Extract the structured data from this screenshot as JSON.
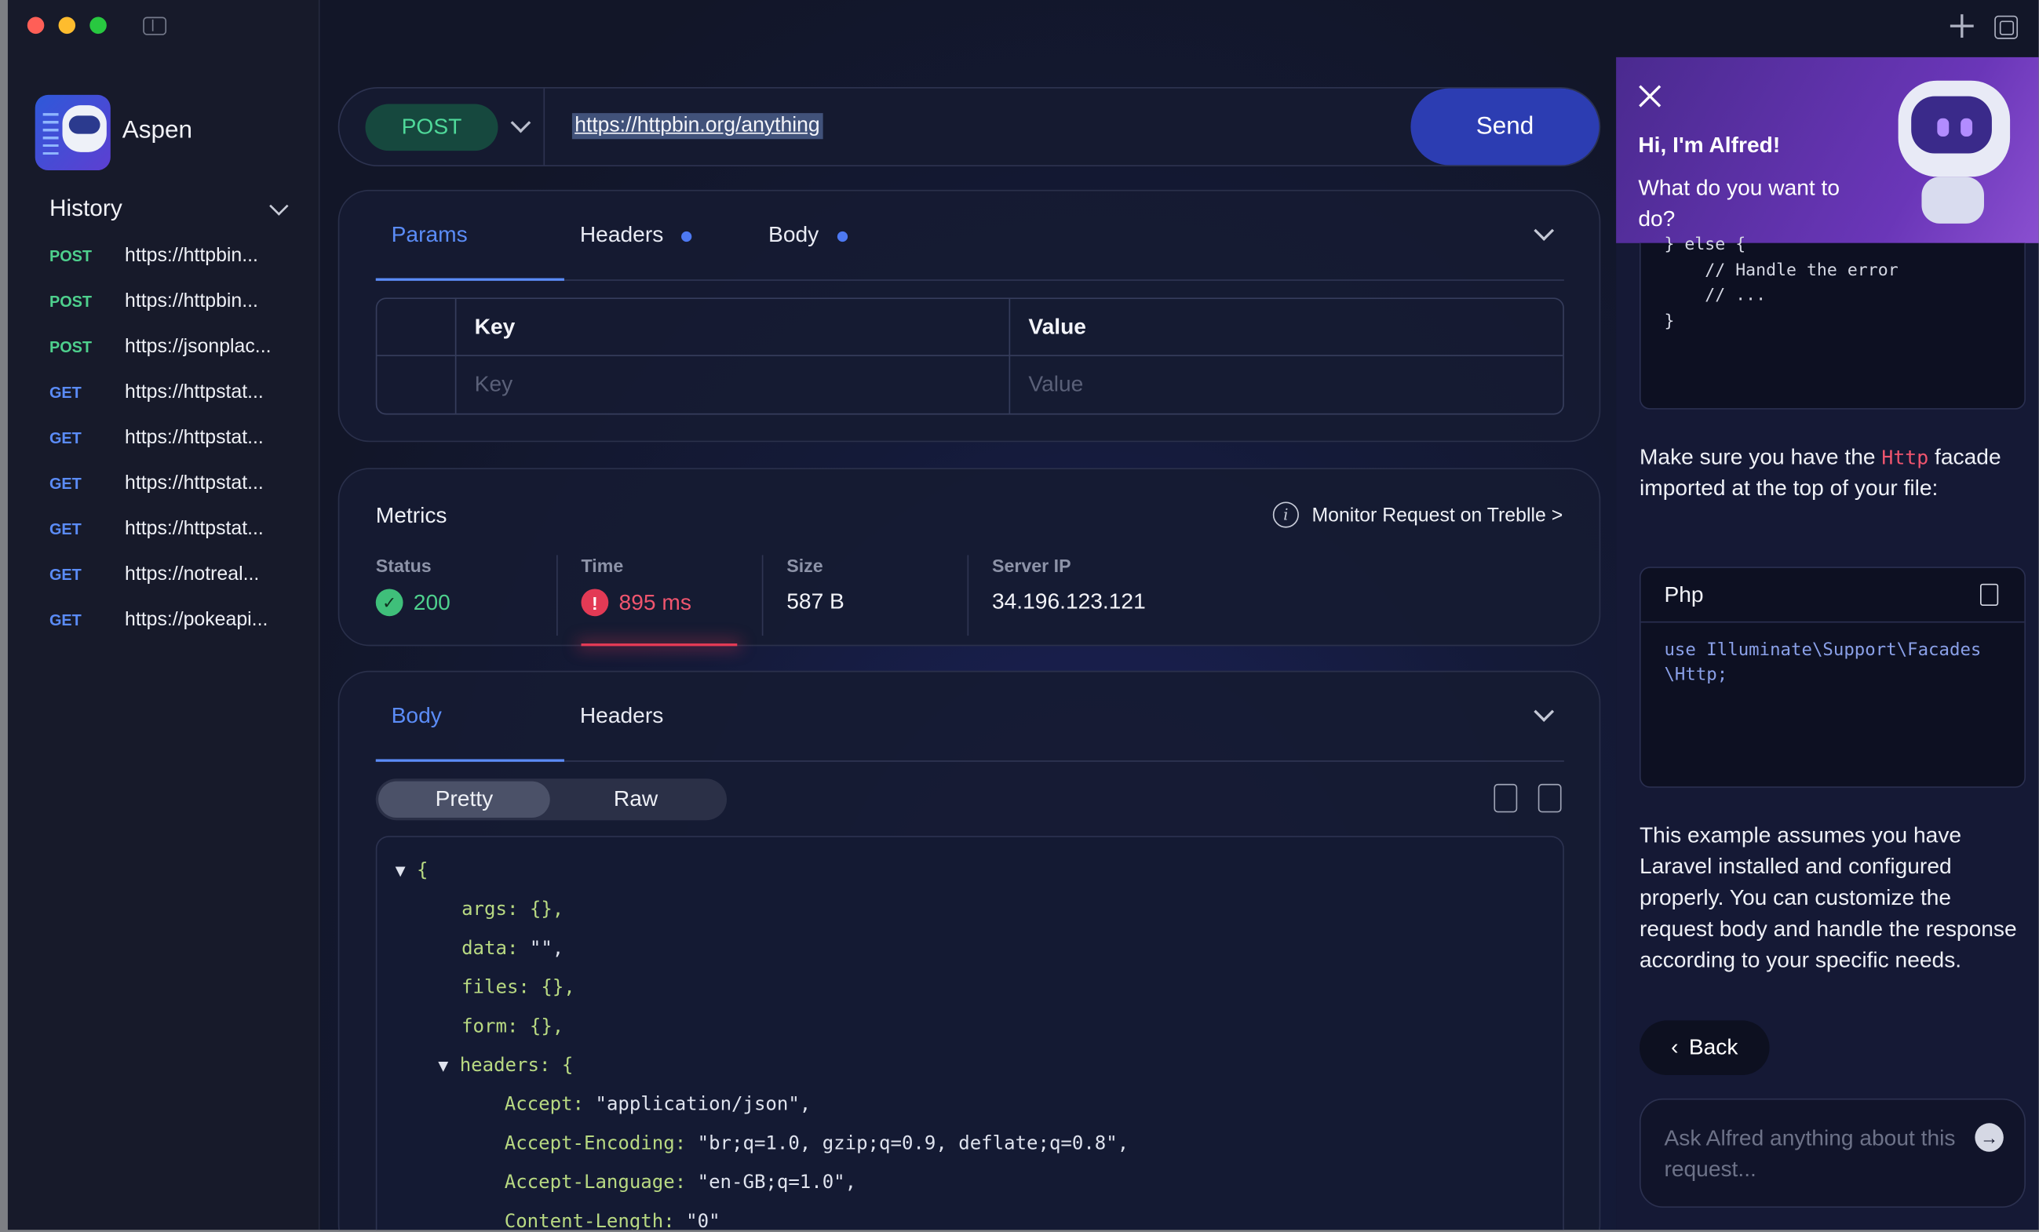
{
  "app": {
    "name": "Aspen"
  },
  "history": {
    "title": "History",
    "items": [
      {
        "method": "POST",
        "url": "https://httpbin..."
      },
      {
        "method": "POST",
        "url": "https://httpbin..."
      },
      {
        "method": "POST",
        "url": "https://jsonplac..."
      },
      {
        "method": "GET",
        "url": "https://httpstat..."
      },
      {
        "method": "GET",
        "url": "https://httpstat..."
      },
      {
        "method": "GET",
        "url": "https://httpstat..."
      },
      {
        "method": "GET",
        "url": "https://httpstat..."
      },
      {
        "method": "GET",
        "url": "https://notreal..."
      },
      {
        "method": "GET",
        "url": "https://pokeapi..."
      }
    ]
  },
  "request": {
    "method": "POST",
    "url": "https://httpbin.org/anything",
    "send_label": "Send",
    "tabs": [
      "Params",
      "Headers",
      "Body"
    ],
    "table": {
      "key_header": "Key",
      "value_header": "Value",
      "key_placeholder": "Key",
      "value_placeholder": "Value"
    }
  },
  "metrics": {
    "title": "Metrics",
    "monitor_link": "Monitor Request on Treblle >",
    "status_label": "Status",
    "status_value": "200",
    "time_label": "Time",
    "time_value": "895 ms",
    "size_label": "Size",
    "size_value": "587 B",
    "ip_label": "Server IP",
    "ip_value": "34.196.123.121",
    "colors": {
      "ok": "#3fbf7a",
      "error": "#e33a55"
    }
  },
  "response": {
    "tabs": [
      "Body",
      "Headers"
    ],
    "view_pretty": "Pretty",
    "view_raw": "Raw",
    "json_lines": [
      {
        "indent": 0,
        "arrow": "▼",
        "text": "{"
      },
      {
        "indent": 1,
        "key": "args",
        "val": "{},",
        "kind": "punc"
      },
      {
        "indent": 1,
        "key": "data",
        "val": "\"\",",
        "kind": "str"
      },
      {
        "indent": 1,
        "key": "files",
        "val": "{},",
        "kind": "punc"
      },
      {
        "indent": 1,
        "key": "form",
        "val": "{},",
        "kind": "punc"
      },
      {
        "indent": 1,
        "arrow": "▼",
        "key": "headers",
        "val": "{",
        "kind": "punc"
      },
      {
        "indent": 2,
        "key": "Accept",
        "val": "\"application/json\",",
        "kind": "str"
      },
      {
        "indent": 2,
        "key": "Accept-Encoding",
        "val": "\"br;q=1.0, gzip;q=0.9, deflate;q=0.8\",",
        "kind": "str"
      },
      {
        "indent": 2,
        "key": "Accept-Language",
        "val": "\"en-GB;q=1.0\",",
        "kind": "str"
      },
      {
        "indent": 2,
        "key": "Content-Length",
        "val": "\"0\"",
        "kind": "str"
      }
    ]
  },
  "alfred": {
    "greeting": "Hi, I'm Alfred!",
    "question": "What do you want to do?",
    "code_snippet": [
      "} else {",
      "    // Handle the error",
      "    // ...",
      "}"
    ],
    "facade_pre": "Make sure you have the ",
    "facade_code": "Http",
    "facade_post": " facade imported at the top of your file:",
    "php_title": "Php",
    "php_code": "use Illuminate\\Support\\Facades\\Http;",
    "assumption": "This example assumes you have Laravel installed and configured properly. You can customize the request body and handle the response according to your specific needs.",
    "back_label": "Back",
    "input_placeholder": "Ask Alfred anything about this request..."
  }
}
